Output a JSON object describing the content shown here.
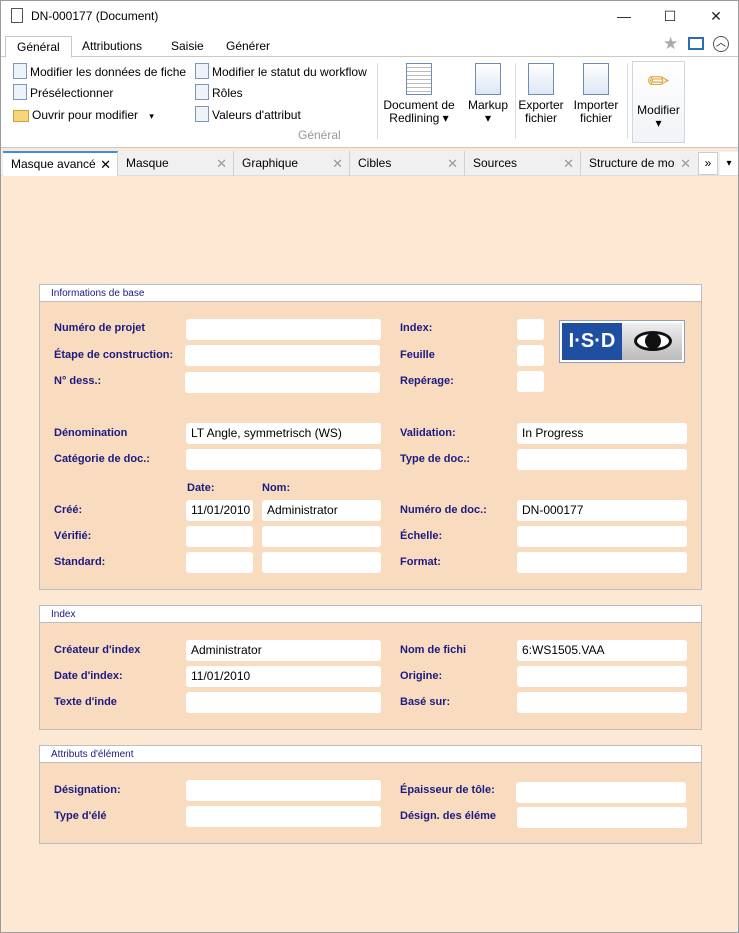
{
  "window": {
    "title": "DN-000177 (Document)",
    "minimize": "—",
    "maximize": "☐",
    "close": "✕"
  },
  "ribbon_tabs": [
    "Général",
    "Attributions",
    "Saisie",
    "Générer"
  ],
  "ribbon": {
    "small_buttons": [
      "Modifier les données de fiche",
      "Présélectionner",
      "Ouvrir pour modifier",
      "Modifier le statut du workflow",
      "Rôles",
      "Valeurs d'attribut"
    ],
    "large_buttons": [
      {
        "l1": "Document de",
        "l2": "Redlining ▾"
      },
      {
        "l1": "Markup",
        "l2": "▾"
      },
      {
        "l1": "Exporter",
        "l2": "fichier"
      },
      {
        "l1": "Importer",
        "l2": "fichier"
      },
      {
        "l1": "Modifier",
        "l2": "▾"
      }
    ],
    "group_label": "Général",
    "dropdown": "▾"
  },
  "doc_tabs": [
    "Masque avancé",
    "Masque",
    "Graphique",
    "Cibles",
    "Sources",
    "Structure de mo"
  ],
  "tab_overflow": "»",
  "tab_menu": "▾",
  "tab_close": "✕",
  "sections": {
    "base": {
      "title": "Informations de base",
      "numero_projet": {
        "label": "Numéro de projet",
        "value": ""
      },
      "etape": {
        "label": "Étape de construction:",
        "value": ""
      },
      "n_dess": {
        "label": "N° dess.:",
        "value": ""
      },
      "index": {
        "label": "Index:",
        "value": ""
      },
      "feuille": {
        "label": "Feuille",
        "value": ""
      },
      "reperage": {
        "label": "Repérage:",
        "value": ""
      },
      "logo": "I·S·D",
      "denomination": {
        "label": "Dénomination",
        "value": "LT Angle, symmetrisch (WS)"
      },
      "validation": {
        "label": "Validation:",
        "value": "In Progress"
      },
      "categorie": {
        "label": "Catégorie de doc.:",
        "value": ""
      },
      "type_doc": {
        "label": "Type de doc.:",
        "value": ""
      },
      "col_date": "Date:",
      "col_nom": "Nom:",
      "cree": {
        "label": "Créé:",
        "date": "11/01/2010",
        "nom": "Administrator"
      },
      "verifie": {
        "label": "Vérifié:",
        "date": "",
        "nom": ""
      },
      "standard": {
        "label": "Standard:",
        "date": "",
        "nom": ""
      },
      "numero_doc": {
        "label": "Numéro de doc.:",
        "value": "DN-000177"
      },
      "echelle": {
        "label": "Échelle:",
        "value": ""
      },
      "format": {
        "label": "Format:",
        "value": ""
      }
    },
    "index": {
      "title": "Index",
      "createur": {
        "label": "Créateur d'index",
        "value": "Administrator"
      },
      "date": {
        "label": "Date d'index:",
        "value": "11/01/2010"
      },
      "texte": {
        "label": "Texte d'index",
        "value": ""
      },
      "nom_fichier": {
        "label": "Nom de fichi",
        "value": "6:WS1505.VAA"
      },
      "origine": {
        "label": "Origine:",
        "value": ""
      },
      "base_sur": {
        "label": "Basé sur:",
        "value": ""
      }
    },
    "element": {
      "title": "Attributs d'élément",
      "designation": {
        "label": "Désignation:",
        "value": ""
      },
      "type": {
        "label": "Type d'élé",
        "value": ""
      },
      "epaisseur": {
        "label": "Épaisseur de tôle:",
        "value": ""
      },
      "design_elem": {
        "label": "Désign. des éléme",
        "value": ""
      }
    }
  }
}
